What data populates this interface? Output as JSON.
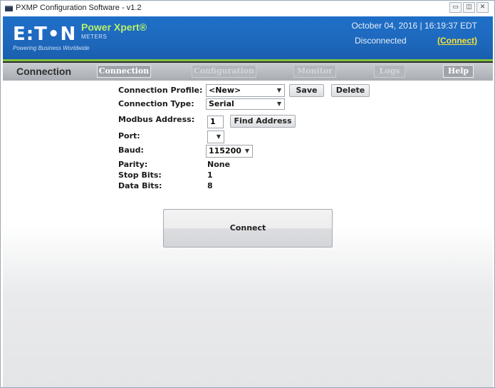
{
  "window": {
    "title": "PXMP Configuration Software - v1.2",
    "controls": {
      "minimize": "▭",
      "maximize": "◫",
      "close": "✕"
    }
  },
  "banner": {
    "logo": "E:T•N",
    "tagline": "Powering Business Worldwide",
    "product": "Power Xpert®",
    "product_sub": "METERS",
    "datetime": "October 04, 2016 | 16:19:37 EDT",
    "status": "Disconnected",
    "connect_link": "(Connect)",
    "colors": {
      "banner_blue": "#1e6ac0",
      "accent_green": "#7fc241",
      "link_yellow": "#f4e23a"
    }
  },
  "nav": {
    "section_title": "Connection",
    "tabs": [
      {
        "label": "Connection",
        "state": "active"
      },
      {
        "label": "Configuration",
        "state": "disabled"
      },
      {
        "label": "Monitor",
        "state": "disabled"
      },
      {
        "label": "Logs",
        "state": "disabled"
      },
      {
        "label": "Help",
        "state": "enabled"
      }
    ]
  },
  "form": {
    "connection_profile": {
      "label": "Connection Profile:",
      "value": "<New>"
    },
    "save_label": "Save",
    "delete_label": "Delete",
    "connection_type": {
      "label": "Connection Type:",
      "value": "Serial"
    },
    "modbus_address": {
      "label": "Modbus Address:",
      "value": "1"
    },
    "find_address_label": "Find Address",
    "port": {
      "label": "Port:",
      "value": ""
    },
    "baud": {
      "label": "Baud:",
      "value": "115200"
    },
    "parity": {
      "label": "Parity:",
      "value": "None"
    },
    "stop_bits": {
      "label": "Stop Bits:",
      "value": "1"
    },
    "data_bits": {
      "label": "Data Bits:",
      "value": "8"
    },
    "connect_label": "Connect",
    "dropdown_arrow": "▼"
  }
}
